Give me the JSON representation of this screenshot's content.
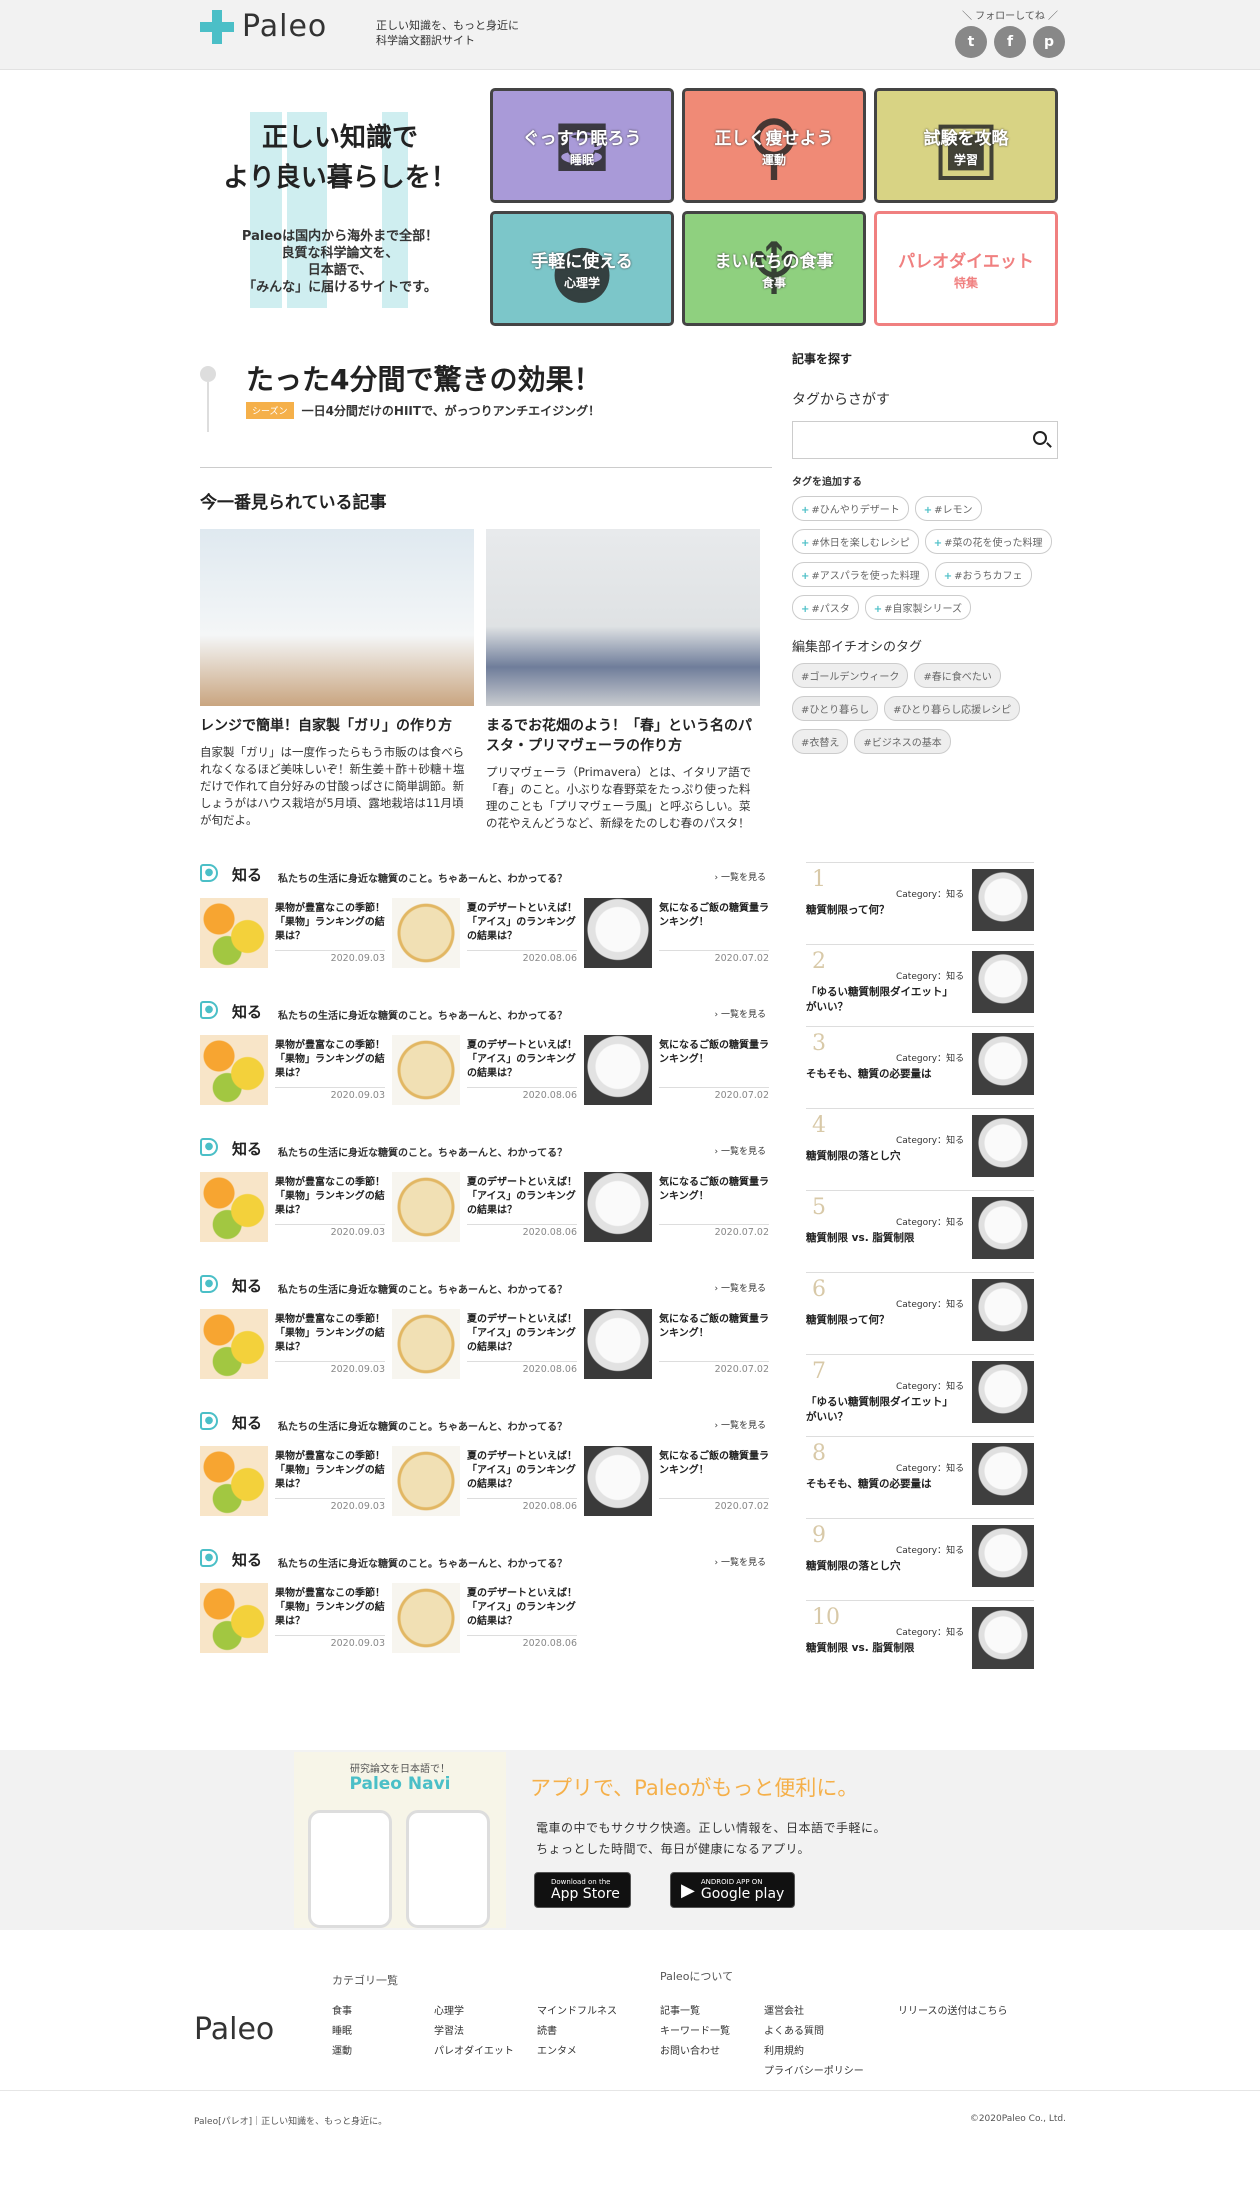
{
  "header": {
    "logo": "Paleo",
    "tagline_1": "正しい知識を、もっと身近に",
    "tagline_2": "科学論文翻訳サイト",
    "follow_label": "＼ フォローしてね ／",
    "social": [
      {
        "icon": "twitter-icon",
        "glyph": "t"
      },
      {
        "icon": "facebook-icon",
        "glyph": "f"
      },
      {
        "icon": "pinterest-icon",
        "glyph": "p"
      }
    ]
  },
  "hero": {
    "title_1": "正しい知識で",
    "title_2": "より良い暮らしを！",
    "desc_1": "Paleoは国内から海外まで全部！",
    "desc_2": "良質な科学論文を、",
    "desc_3": "日本語で、",
    "desc_4": "「みんな」に届けるサイトです。",
    "categories": [
      {
        "title": "ぐっすり眠ろう",
        "sub": "睡眠",
        "bg": "#a99ad8",
        "glyph": "⛾"
      },
      {
        "title": "正しく痩せよう",
        "sub": "運動",
        "bg": "#f08a76",
        "glyph": "⚲"
      },
      {
        "title": "試験を攻略",
        "sub": "学習",
        "bg": "#d8d384",
        "glyph": "▣"
      },
      {
        "title": "手軽に使える",
        "sub": "心理学",
        "bg": "#7cc6c9",
        "glyph": "●"
      },
      {
        "title": "まいにちの食事",
        "sub": "食事",
        "bg": "#8fd07f",
        "glyph": "♆"
      },
      {
        "title": "パレオダイエット",
        "sub": "特集",
        "bg": "#ffffff",
        "glyph": ""
      }
    ]
  },
  "feature": {
    "title": "たった4分間で驚きの効果！",
    "badge": "シーズン",
    "subtitle": "一日4分間だけのHIITで、がっつりアンチエイジング！"
  },
  "popular": {
    "heading": "今一番見られている記事",
    "articles": [
      {
        "title": "レンジで簡単！自家製「ガリ」の作り方",
        "text": "自家製「ガリ」は一度作ったらもう市販のは食べられなくなるほど美味しいぞ！新生姜＋酢＋砂糖＋塩だけで作れて自分好みの甘酸っぱさに簡単調節。新しょうがはハウス栽培が5月頃、露地栽培は11月頃が旬だよ。"
      },
      {
        "title": "まるでお花畑のよう！「春」という名のパスタ・プリマヴェーラの作り方",
        "text": "プリマヴェーラ（Primavera）とは、イタリア語で「春」のこと。小ぶりな春野菜をたっぷり使った料理のことも「プリマヴェーラ風」と呼ぶらしい。菜の花やえんどうなど、新緑をたのしむ春のパスタ！"
      }
    ]
  },
  "rows": [
    {
      "label": "知る",
      "sub": "私たちの生活に身近な糖質のこと。ちゃあーんと、わかってる？",
      "more": "一覧を見る",
      "items": [
        {
          "title": "果物が豊富なこの季節！「果物」ランキングの結果は？",
          "date": "2020.09.03",
          "img": "img-fruit"
        },
        {
          "title": "夏のデザートといえば！「アイス」のランキングの結果は？",
          "date": "2020.08.06",
          "img": "img-ice"
        },
        {
          "title": "気になるご飯の糖質量ランキング！",
          "date": "2020.07.02",
          "img": "img-rice"
        }
      ]
    },
    {
      "label": "知る",
      "sub": "私たちの生活に身近な糖質のこと。ちゃあーんと、わかってる？",
      "more": "一覧を見る",
      "items": [
        {
          "title": "果物が豊富なこの季節！「果物」ランキングの結果は？",
          "date": "2020.09.03",
          "img": "img-fruit"
        },
        {
          "title": "夏のデザートといえば！「アイス」のランキングの結果は？",
          "date": "2020.08.06",
          "img": "img-ice"
        },
        {
          "title": "気になるご飯の糖質量ランキング！",
          "date": "2020.07.02",
          "img": "img-rice"
        }
      ]
    },
    {
      "label": "知る",
      "sub": "私たちの生活に身近な糖質のこと。ちゃあーんと、わかってる？",
      "more": "一覧を見る",
      "items": [
        {
          "title": "果物が豊富なこの季節！「果物」ランキングの結果は？",
          "date": "2020.09.03",
          "img": "img-fruit"
        },
        {
          "title": "夏のデザートといえば！「アイス」のランキングの結果は？",
          "date": "2020.08.06",
          "img": "img-ice"
        },
        {
          "title": "気になるご飯の糖質量ランキング！",
          "date": "2020.07.02",
          "img": "img-rice"
        }
      ]
    },
    {
      "label": "知る",
      "sub": "私たちの生活に身近な糖質のこと。ちゃあーんと、わかってる？",
      "more": "一覧を見る",
      "items": [
        {
          "title": "果物が豊富なこの季節！「果物」ランキングの結果は？",
          "date": "2020.09.03",
          "img": "img-fruit"
        },
        {
          "title": "夏のデザートといえば！「アイス」のランキングの結果は？",
          "date": "2020.08.06",
          "img": "img-ice"
        },
        {
          "title": "気になるご飯の糖質量ランキング！",
          "date": "2020.07.02",
          "img": "img-rice"
        }
      ]
    },
    {
      "label": "知る",
      "sub": "私たちの生活に身近な糖質のこと。ちゃあーんと、わかってる？",
      "more": "一覧を見る",
      "items": [
        {
          "title": "果物が豊富なこの季節！「果物」ランキングの結果は？",
          "date": "2020.09.03",
          "img": "img-fruit"
        },
        {
          "title": "夏のデザートといえば！「アイス」のランキングの結果は？",
          "date": "2020.08.06",
          "img": "img-ice"
        },
        {
          "title": "気になるご飯の糖質量ランキング！",
          "date": "2020.07.02",
          "img": "img-rice"
        }
      ]
    },
    {
      "label": "知る",
      "sub": "私たちの生活に身近な糖質のこと。ちゃあーんと、わかってる？",
      "more": "一覧を見る",
      "items": [
        {
          "title": "果物が豊富なこの季節！「果物」ランキングの結果は？",
          "date": "2020.09.03",
          "img": "img-fruit"
        },
        {
          "title": "夏のデザートといえば！「アイス」のランキングの結果は？",
          "date": "2020.08.06",
          "img": "img-ice"
        }
      ]
    }
  ],
  "sidebar": {
    "heading": "記事を探す",
    "tag_search": "タグからさがす",
    "search_placeholder": "",
    "add_tag": "タグを追加する",
    "tags": [
      "#ひんやりデザート",
      "#レモン",
      "#休日を楽しむレシピ",
      "#菜の花を使った料理",
      "#アスパラを使った料理",
      "#おうちカフェ",
      "#パスタ",
      "#自家製シリーズ"
    ],
    "pick_heading": "編集部イチオシのタグ",
    "picks": [
      "#ゴールデンウィーク",
      "#春に食べたい",
      "#ひとり暮らし",
      "#ひとり暮らし応援レシピ",
      "#衣替え",
      "#ビジネスの基本"
    ]
  },
  "ranking": [
    {
      "num": "1",
      "cat": "Category：知る",
      "title": "糖質制限って何？"
    },
    {
      "num": "2",
      "cat": "Category：知る",
      "title": "「ゆるい糖質制限ダイエット」がいい？"
    },
    {
      "num": "3",
      "cat": "Category：知る",
      "title": "そもそも、糖質の必要量は"
    },
    {
      "num": "4",
      "cat": "Category：知る",
      "title": "糖質制限の落とし穴"
    },
    {
      "num": "5",
      "cat": "Category：知る",
      "title": "糖質制限 vs. 脂質制限"
    },
    {
      "num": "6",
      "cat": "Category：知る",
      "title": "糖質制限って何？"
    },
    {
      "num": "7",
      "cat": "Category：知る",
      "title": "「ゆるい糖質制限ダイエット」がいい？"
    },
    {
      "num": "8",
      "cat": "Category：知る",
      "title": "そもそも、糖質の必要量は"
    },
    {
      "num": "9",
      "cat": "Category：知る",
      "title": "糖質制限の落とし穴"
    },
    {
      "num": "10",
      "cat": "Category：知る",
      "title": "糖質制限 vs. 脂質制限"
    }
  ],
  "app": {
    "img_t1": "研究論文を日本語で！",
    "img_t2": "Paleo Navi",
    "title": "アプリで、Paleoがもっと便利に。",
    "text_1": "電車の中でもサクサク快適。正しい情報を、日本語で手軽に。",
    "text_2": "ちょっとした時間で、毎日が健康になるアプリ。",
    "appstore_small": "Download on the",
    "appstore_big": "App Store",
    "google_small": "ANDROID APP ON",
    "google_big": "Google play"
  },
  "footer": {
    "logo": "Paleo",
    "cat_heading": "カテゴリ一覧",
    "about_heading": "Paleoについて",
    "cats": [
      "食事",
      "睡眠",
      "運動",
      "心理学",
      "学習法",
      "パレオダイエット",
      "マインドフルネス",
      "読書",
      "エンタメ"
    ],
    "about": [
      "記事一覧",
      "キーワード一覧",
      "お問い合わせ",
      "運営会社",
      "よくある質問",
      "利用規約",
      "プライバシーポリシー"
    ],
    "release": "リリースの送付はこちら",
    "copy_left": "Paleo[パレオ]｜正しい知識を、もっと身近に。",
    "copy_right": "©2020Paleo Co., Ltd."
  }
}
